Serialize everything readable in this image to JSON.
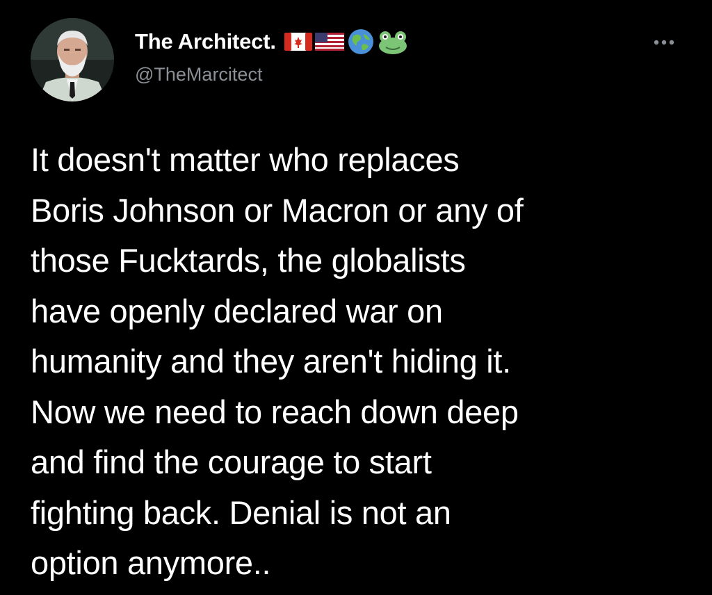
{
  "tweet": {
    "author": {
      "display_name": "The Architect.",
      "handle": "@TheMarcitect",
      "avatar_icon": "avatar-photo-bearded-man",
      "badges": [
        "canada-flag-icon",
        "usa-flag-icon",
        "globe-icon",
        "frog-icon"
      ]
    },
    "more_icon": "more-options-icon",
    "text": "It doesn't matter who replaces\nBoris Johnson or Macron or any of\nthose Fucktards, the globalists\nhave openly declared war on\nhumanity and they aren't hiding it.\nNow we need to reach down deep\nand find the courage to start\nfighting back. Denial is not an\noption anymore.."
  },
  "colors": {
    "background": "#000000",
    "text_primary": "#ffffff",
    "text_secondary": "#8b9096"
  }
}
